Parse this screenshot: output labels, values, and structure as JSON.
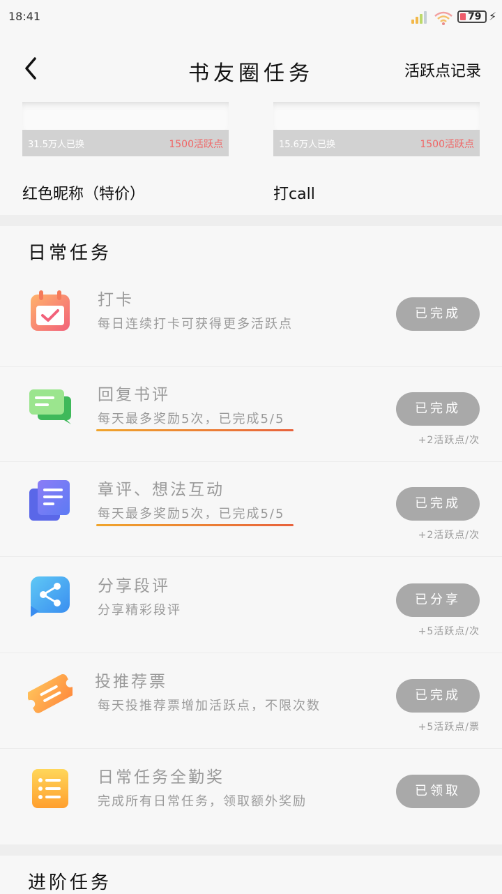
{
  "status_bar": {
    "time": "18:41",
    "battery": "79"
  },
  "nav": {
    "title": "书友圈任务",
    "record_link": "活跃点记录"
  },
  "rewards": [
    {
      "count": "31.5万人已换",
      "price": "1500活跃点",
      "name": "红色昵称（特价）"
    },
    {
      "count": "15.6万人已换",
      "price": "1500活跃点",
      "name": "打call"
    }
  ],
  "daily": {
    "title": "日常任务",
    "tasks": [
      {
        "name": "打卡",
        "desc": "每日连续打卡可获得更多活跃点",
        "button": "已完成",
        "reward": "",
        "icon": "calendar-check-icon"
      },
      {
        "name": "回复书评",
        "desc": "每天最多奖励5次，已完成5/5",
        "button": "已完成",
        "reward": "+2活跃点/次",
        "icon": "chat-bubbles-icon"
      },
      {
        "name": "章评、想法互动",
        "desc": "每天最多奖励5次，已完成5/5",
        "button": "已完成",
        "reward": "+2活跃点/次",
        "icon": "document-stack-icon"
      },
      {
        "name": "分享段评",
        "desc": "分享精彩段评",
        "button": "已分享",
        "reward": "+5活跃点/次",
        "icon": "share-icon"
      },
      {
        "name": "投推荐票",
        "desc": "每天投推荐票增加活跃点，不限次数",
        "button": "已完成",
        "reward": "+5活跃点/票",
        "icon": "ticket-icon"
      },
      {
        "name": "日常任务全勤奖",
        "desc": "完成所有日常任务，领取额外奖励",
        "button": "已领取",
        "reward": "",
        "icon": "list-icon"
      }
    ]
  },
  "advanced": {
    "title": "进阶任务"
  },
  "colors": {
    "accent_red": "#f06565",
    "button_gray": "#a9a9a9",
    "progress_start": "#f0a52c",
    "progress_end": "#e8623c"
  }
}
